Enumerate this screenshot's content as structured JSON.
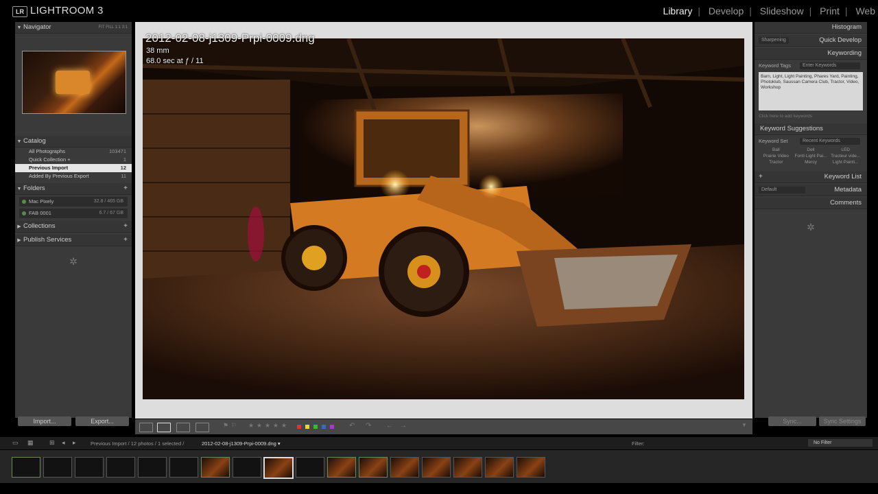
{
  "app": {
    "logo_badge": "LR",
    "title": "LIGHTROOM 3",
    "modules": [
      "Library",
      "Develop",
      "Slideshow",
      "Print",
      "Web"
    ],
    "active_module": "Library"
  },
  "left_panel": {
    "navigator": {
      "label": "Navigator",
      "zoom_opts": "FIT  FILL  1:1  3:1"
    },
    "catalog": {
      "label": "Catalog",
      "items": [
        {
          "label": "All Photographs",
          "count": "103471"
        },
        {
          "label": "Quick Collection +",
          "count": "1"
        },
        {
          "label": "Previous Import",
          "count": "12"
        },
        {
          "label": "Added By Previous Export",
          "count": "11"
        }
      ]
    },
    "folders": {
      "label": "Folders",
      "items": [
        {
          "label": "Mac Pixely",
          "count": "32.8 / 465 GB"
        },
        {
          "label": "FAB 0001",
          "count": "6.7 / 67 GB"
        }
      ]
    },
    "collections_label": "Collections",
    "publish_label": "Publish Services",
    "import_label": "Import...",
    "export_label": "Export..."
  },
  "right_panel": {
    "histogram_label": "Histogram",
    "quick_develop_label": "Quick Develop",
    "quick_develop_preset": "Sharpening",
    "keywording_label": "Keywording",
    "keyword_tags_label": "Keyword Tags",
    "keyword_tags_value": "Enter Keywords",
    "keywords_text": "Barn, Light, Light Painting, Phares Yard, Painting, Photoklub, Saussan Camera Club, Tractor, Video, Workshop",
    "keywords_placeholder": "Click here to add keywords",
    "suggestions_label": "Keyword Suggestions",
    "keyword_set_label": "Keyword Set",
    "keyword_set_value": "Recent Keywords",
    "suggestions": [
      "Ball",
      "Dell",
      "LED",
      "Prairie Video",
      "Fonti Light Pai...",
      "Tracteur vide...",
      "Tractor",
      "Mercy",
      "Light Painti..."
    ],
    "keyword_list_label": "Keyword List",
    "metadata_label": "Metadata",
    "metadata_preset": "Default",
    "comments_label": "Comments",
    "sync_label": "Sync...",
    "sync_settings_label": "Sync Settings"
  },
  "photo": {
    "filename": "2012-02-08-j1309-Prpi-0009.dng",
    "focal_length": "38 mm",
    "exposure": "68.0 sec at ƒ / 11"
  },
  "filmbar": {
    "path_prefix": "Previous Import / 12 photos / 1 selected /",
    "path_file": "2012-02-08-j1309-Prpi-0009.dng ▾",
    "filter_label": "Filter:",
    "filter_value": "No Filter"
  },
  "filmstrip": {
    "thumb_count": 17,
    "selected_index": 8
  }
}
